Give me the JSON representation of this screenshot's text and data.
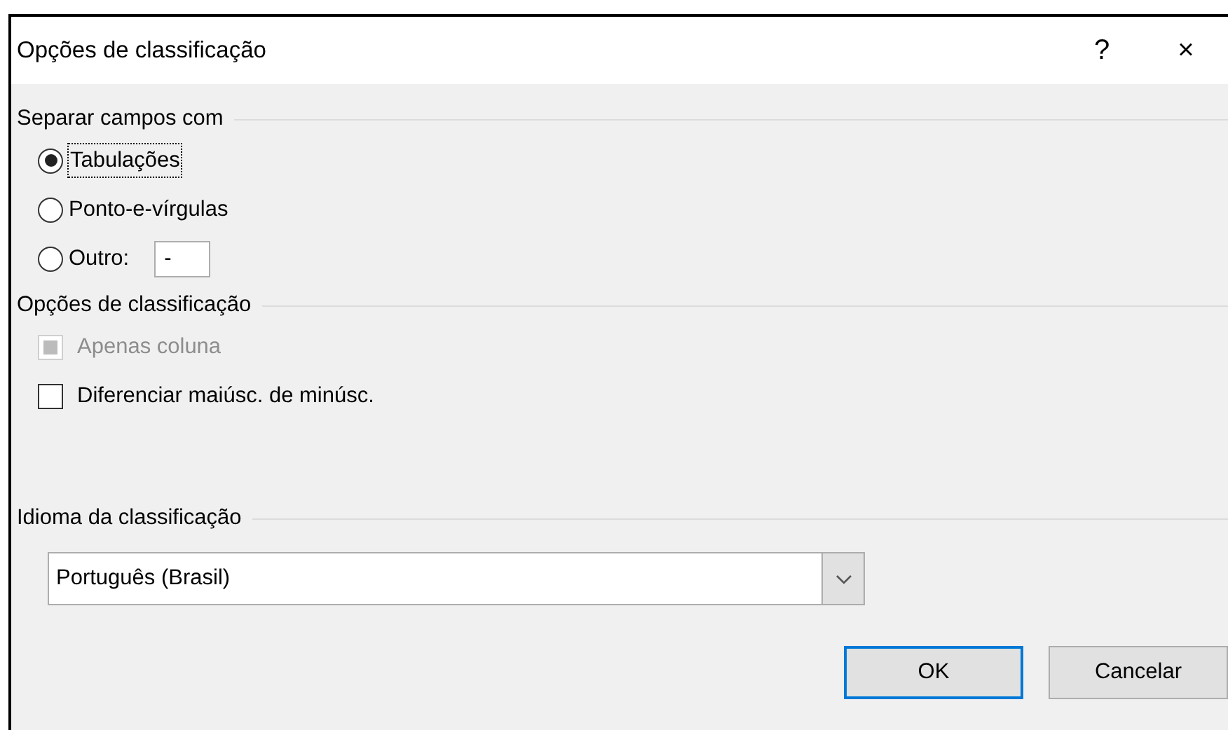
{
  "window": {
    "title": "Opções de classificação",
    "help": "?",
    "close": "×"
  },
  "separator_group": {
    "heading": "Separar campos com",
    "options": [
      {
        "kind": "radio",
        "label": "Tabulações",
        "selected": true,
        "focused": true
      },
      {
        "kind": "radio",
        "label": "Ponto-e-vírgulas",
        "selected": false,
        "focused": false
      },
      {
        "kind": "radio-with-field",
        "label": "Outro:",
        "selected": false,
        "focused": false,
        "field": {
          "value": "-"
        }
      }
    ]
  },
  "sort_options": {
    "heading": "Opções de classificação",
    "checkboxes": [
      {
        "label": "Apenas coluna",
        "checked": true,
        "disabled": true
      },
      {
        "label": "Diferenciar maiúsc. de minúsc.",
        "checked": false,
        "disabled": false
      }
    ]
  },
  "language": {
    "heading": "Idioma da classificação",
    "value": "Português (Brasil)"
  },
  "buttons": [
    {
      "label": "OK",
      "default": true
    },
    {
      "label": "Cancelar",
      "default": false
    }
  ]
}
